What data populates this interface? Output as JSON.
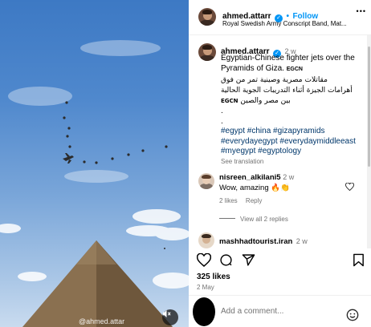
{
  "media": {
    "watermark": "@ahmed.attar"
  },
  "header": {
    "username": "ahmed.attarr",
    "follow_label": "Follow",
    "separator": "•",
    "subtitle": "Royal Swedish Army Conscript Band, Mat...",
    "more_label": "•••"
  },
  "caption": {
    "username": "ahmed.attarr",
    "time": "2 w",
    "text_en": "Egyptian-Chinese fighter jets over the Pyramids of Giza.",
    "source_tag": "EGCN",
    "text_ar_1": "مقاتلات مصرية وصينية تمر من فوق",
    "text_ar_2": "أهرامات الجيزة أثناء التدريبات الجوية الحالية",
    "text_ar_3": "بين مصر والصين",
    "dot1": ".",
    "dot2": ".",
    "hashtags_1": "#egypt #china #gizapyramids",
    "hashtags_2": "#everydayegypt #everydaymiddleeast",
    "hashtags_3": "#myegypt #egyptology",
    "see_translation": "See translation"
  },
  "comments": [
    {
      "username": "nisreen_alkilani5",
      "time": "2 w",
      "text": "Wow, amazing 🔥👏",
      "likes": "2 likes",
      "reply": "Reply"
    },
    {
      "username": "mashhadtourist.iran",
      "time": "2 w"
    }
  ],
  "view_replies": "View all 2 replies",
  "likes_count": "325 likes",
  "date": "2 May",
  "comment_placeholder": "Add a comment...",
  "icons": {
    "like": "heart-icon",
    "comment": "comment-icon",
    "share": "share-icon",
    "save": "bookmark-icon",
    "emoji": "emoji-icon",
    "mute": "mute-icon"
  },
  "colors": {
    "accent": "#0095f6",
    "hashtag": "#00376b",
    "secondary_text": "#737373"
  }
}
